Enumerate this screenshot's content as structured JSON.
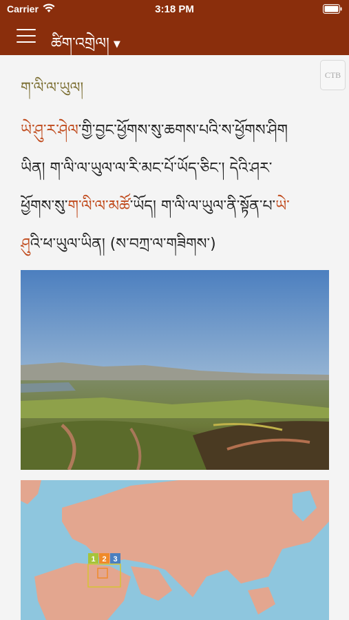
{
  "status_bar": {
    "carrier": "Carrier",
    "time": "3:18 PM"
  },
  "nav": {
    "title": "ཚིག་འགྲེལ།",
    "caret": "▼"
  },
  "ctb_button": "CTB",
  "article": {
    "heading": "ག་ལི་ལ་ཡུལ།",
    "lines": [
      [
        "ཡེ་ཤུ་ར་ཤེལ",
        "་གྱི་བྱང་ཕྱོགས་སུ་ཆགས་པའི་ས་ཕྱོགས་ཤིག"
      ],
      [
        "ཡིན། ག་ལི་ལ་ཡུལ་ལ་རི་མང་པོ་ཡོད་ཅིང་། དེའི་ཤར་"
      ],
      [
        "ཕྱོགས་སུ་",
        "ག་ལི་ལ་མཚོ",
        "་ཡོད། ག་ལི་ལ་ཡུལ་ནི་སྟོན་པ་",
        "ཡེ་"
      ],
      [
        "ཤུ",
        "འི་ཕ་ཡུལ་ཡིན། (ས་བཀྲ་ལ་གཟིགས་)"
      ]
    ]
  },
  "map": {
    "labels": [
      "1",
      "2",
      "3"
    ]
  },
  "colors": {
    "nav_bg": "#8a2e0c",
    "link": "#c04a1c",
    "heading": "#7c6f33"
  }
}
